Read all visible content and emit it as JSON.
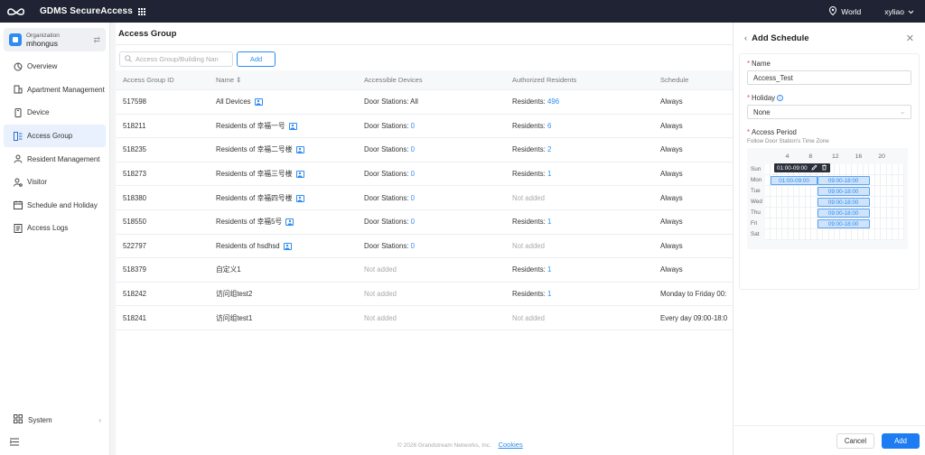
{
  "app": {
    "name": "GDMS SecureAccess"
  },
  "topbar": {
    "region": "World",
    "user": "xyliao"
  },
  "org": {
    "label": "Organization",
    "name": "mhongus"
  },
  "sidebar": {
    "items": [
      {
        "label": "Overview",
        "icon": "overview-icon"
      },
      {
        "label": "Apartment Management",
        "icon": "apartment-icon"
      },
      {
        "label": "Device",
        "icon": "device-icon"
      },
      {
        "label": "Access Group",
        "icon": "access-group-icon"
      },
      {
        "label": "Resident Management",
        "icon": "resident-icon"
      },
      {
        "label": "Visitor",
        "icon": "visitor-icon"
      },
      {
        "label": "Schedule and Holiday",
        "icon": "calendar-icon"
      },
      {
        "label": "Access Logs",
        "icon": "logs-icon"
      }
    ],
    "active": "Access Group",
    "system": "System"
  },
  "page": {
    "title": "Access Group",
    "search_placeholder": "Access Group/Building Nan",
    "add_label": "Add",
    "columns": [
      "Access Group ID",
      "Name",
      "Accessible Devices",
      "Authorized Residents",
      "Schedule"
    ],
    "rows": [
      {
        "id": "517598",
        "name": "All Devices",
        "devices": "Door Stations: All",
        "devices_count": "",
        "residents": "Residents: ",
        "residents_count": "496",
        "schedule": "Always",
        "badge": true
      },
      {
        "id": "518211",
        "name": "Residents of 幸福一号",
        "devices": "Door Stations: ",
        "devices_count": "0",
        "residents": "Residents: ",
        "residents_count": "6",
        "schedule": "Always",
        "badge": true
      },
      {
        "id": "518235",
        "name": "Residents of 幸福二号楼",
        "devices": "Door Stations: ",
        "devices_count": "0",
        "residents": "Residents: ",
        "residents_count": "2",
        "schedule": "Always",
        "badge": true
      },
      {
        "id": "518273",
        "name": "Residents of 幸福三号楼",
        "devices": "Door Stations: ",
        "devices_count": "0",
        "residents": "Residents: ",
        "residents_count": "1",
        "schedule": "Always",
        "badge": true
      },
      {
        "id": "518380",
        "name": "Residents of 幸福四号楼",
        "devices": "Door Stations: ",
        "devices_count": "0",
        "residents": "Not added",
        "residents_count": "",
        "schedule": "Always",
        "badge": true
      },
      {
        "id": "518550",
        "name": "Residents of 幸福5号",
        "devices": "Door Stations: ",
        "devices_count": "0",
        "residents": "Residents: ",
        "residents_count": "1",
        "schedule": "Always",
        "badge": true
      },
      {
        "id": "522797",
        "name": "Residents of hsdhsd",
        "devices": "Door Stations: ",
        "devices_count": "0",
        "residents": "Not added",
        "residents_count": "",
        "schedule": "Always",
        "badge": true
      },
      {
        "id": "518379",
        "name": "自定义1",
        "devices": "Not added",
        "devices_count": "",
        "residents": "Residents: ",
        "residents_count": "1",
        "schedule": "Always",
        "badge": false
      },
      {
        "id": "518242",
        "name": "访问组test2",
        "devices": "Not added",
        "devices_count": "",
        "residents": "Residents: ",
        "residents_count": "1",
        "schedule": "Monday to Friday 00:",
        "badge": false
      },
      {
        "id": "518241",
        "name": "访问组test1",
        "devices": "Not added",
        "devices_count": "",
        "residents": "Not added",
        "residents_count": "",
        "schedule": "Every day 09:00-18:0",
        "badge": false
      }
    ],
    "footer": "© 2026 Grandstream Networks, Inc.",
    "cookies": "Cookies"
  },
  "drawer": {
    "title": "Add Schedule",
    "name_label": "Name",
    "name_value": "Access_Test",
    "holiday_label": "Holiday",
    "holiday_value": "None",
    "period_label": "Access Period",
    "period_hint": "Follow Door Station's Time Zone",
    "hours": [
      "4",
      "8",
      "12",
      "16",
      "20"
    ],
    "days": [
      "Sun",
      "Mon",
      "Tue",
      "Wed",
      "Thu",
      "Fri",
      "Sat"
    ],
    "blocks": [
      {
        "day": 1,
        "label": "01:00-09:00"
      },
      {
        "day": 1,
        "label": "09:00-18:00"
      },
      {
        "day": 2,
        "label": "09:00-18:00"
      },
      {
        "day": 3,
        "label": "09:00-18:00"
      },
      {
        "day": 4,
        "label": "09:00-18:00"
      },
      {
        "day": 5,
        "label": "09:00-18:00"
      }
    ],
    "tooltip": "01:00-09:00",
    "cancel": "Cancel",
    "add": "Add"
  },
  "colors": {
    "primary": "#2d8cf0",
    "topbar": "#1f2333",
    "active_nav": "#e8f1fd"
  }
}
